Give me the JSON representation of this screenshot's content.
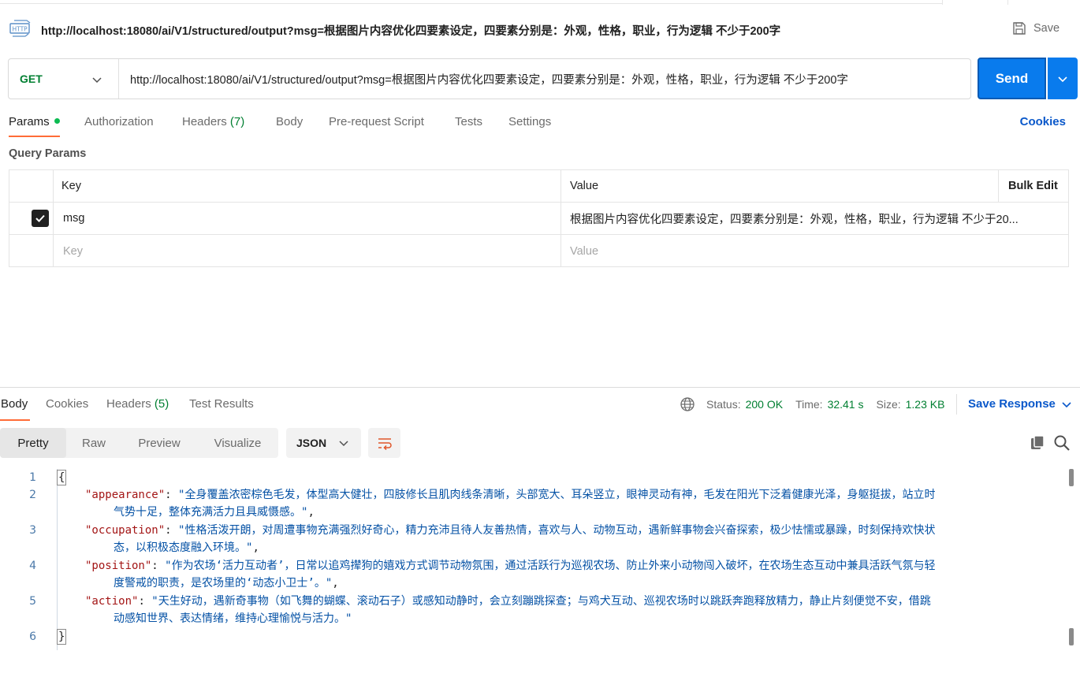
{
  "request": {
    "title": "http://localhost:18080/ai/V1/structured/output?msg=根据图片内容优化四要素设定，四要素分别是：外观，性格，职业，行为逻辑 不少于200字",
    "save_label": "Save",
    "method": "GET",
    "url": "http://localhost:18080/ai/V1/structured/output?msg=根据图片内容优化四要素设定，四要素分别是：外观，性格，职业，行为逻辑 不少于200字",
    "send_label": "Send",
    "tabs": {
      "params": "Params",
      "authorization": "Authorization",
      "headers": "Headers",
      "headers_count": "(7)",
      "body": "Body",
      "prerequest": "Pre-request Script",
      "tests": "Tests",
      "settings": "Settings"
    },
    "cookies_label": "Cookies",
    "query_params_title": "Query Params",
    "table": {
      "col_key": "Key",
      "col_value": "Value",
      "bulk_edit": "Bulk Edit",
      "rows": [
        {
          "checked": true,
          "key": "msg",
          "value": "根据图片内容优化四要素设定，四要素分别是：外观，性格，职业，行为逻辑 不少于20..."
        }
      ],
      "key_placeholder": "Key",
      "value_placeholder": "Value"
    }
  },
  "response": {
    "tabs": {
      "body": "Body",
      "cookies": "Cookies",
      "headers": "Headers",
      "headers_count": "(5)",
      "test_results": "Test Results"
    },
    "status_label": "Status:",
    "status_value": "200 OK",
    "time_label": "Time:",
    "time_value": "32.41 s",
    "size_label": "Size:",
    "size_value": "1.23 KB",
    "save_response": "Save Response",
    "views": {
      "pretty": "Pretty",
      "raw": "Raw",
      "preview": "Preview",
      "visualize": "Visualize"
    },
    "format": "JSON",
    "line_numbers": [
      "1",
      "2",
      "3",
      "4",
      "5",
      "6"
    ],
    "json": {
      "open": "{",
      "close": "}",
      "appearance_key": "\"appearance\"",
      "appearance_l1": "\"全身覆盖浓密棕色毛发，体型高大健壮，四肢修长且肌肉线条清晰，头部宽大、耳朵竖立，眼神灵动有神，毛发在阳光下泛着健康光泽，身躯挺拔，站立时",
      "appearance_l2": "气势十足，整体充满活力且具威慑感。\"",
      "occupation_key": "\"occupation\"",
      "occupation_l1": "\"性格活泼开朗，对周遭事物充满强烈好奇心，精力充沛且待人友善热情，喜欢与人、动物互动，遇新鲜事物会兴奋探索，极少怯懦或暴躁，时刻保持欢快状",
      "occupation_l2": "态，以积极态度融入环境。\"",
      "position_key": "\"position\"",
      "position_l1": "\"作为农场‘活力互动者’，日常以追鸡撵狗的嬉戏方式调节动物氛围，通过活跃行为巡视农场、防止外来小动物闯入破坏，在农场生态互动中兼具活跃气氛与轻",
      "position_l2": "度警戒的职责，是农场里的‘动态小卫士’。\"",
      "action_key": "\"action\"",
      "action_l1": "\"天生好动，遇新奇事物（如飞舞的蝴蝶、滚动石子）或感知动静时，会立刻蹦跳探查；与鸡犬互动、巡视农场时以跳跃奔跑释放精力，静止片刻便觉不安，借跳",
      "action_l2": "动感知世界、表达情绪，维持心理愉悦与活力。\""
    }
  },
  "colors": {
    "accent_orange": "#ff6c37",
    "send_blue": "#097bed",
    "method_green": "#007f31",
    "link_blue": "#0a58ca"
  }
}
